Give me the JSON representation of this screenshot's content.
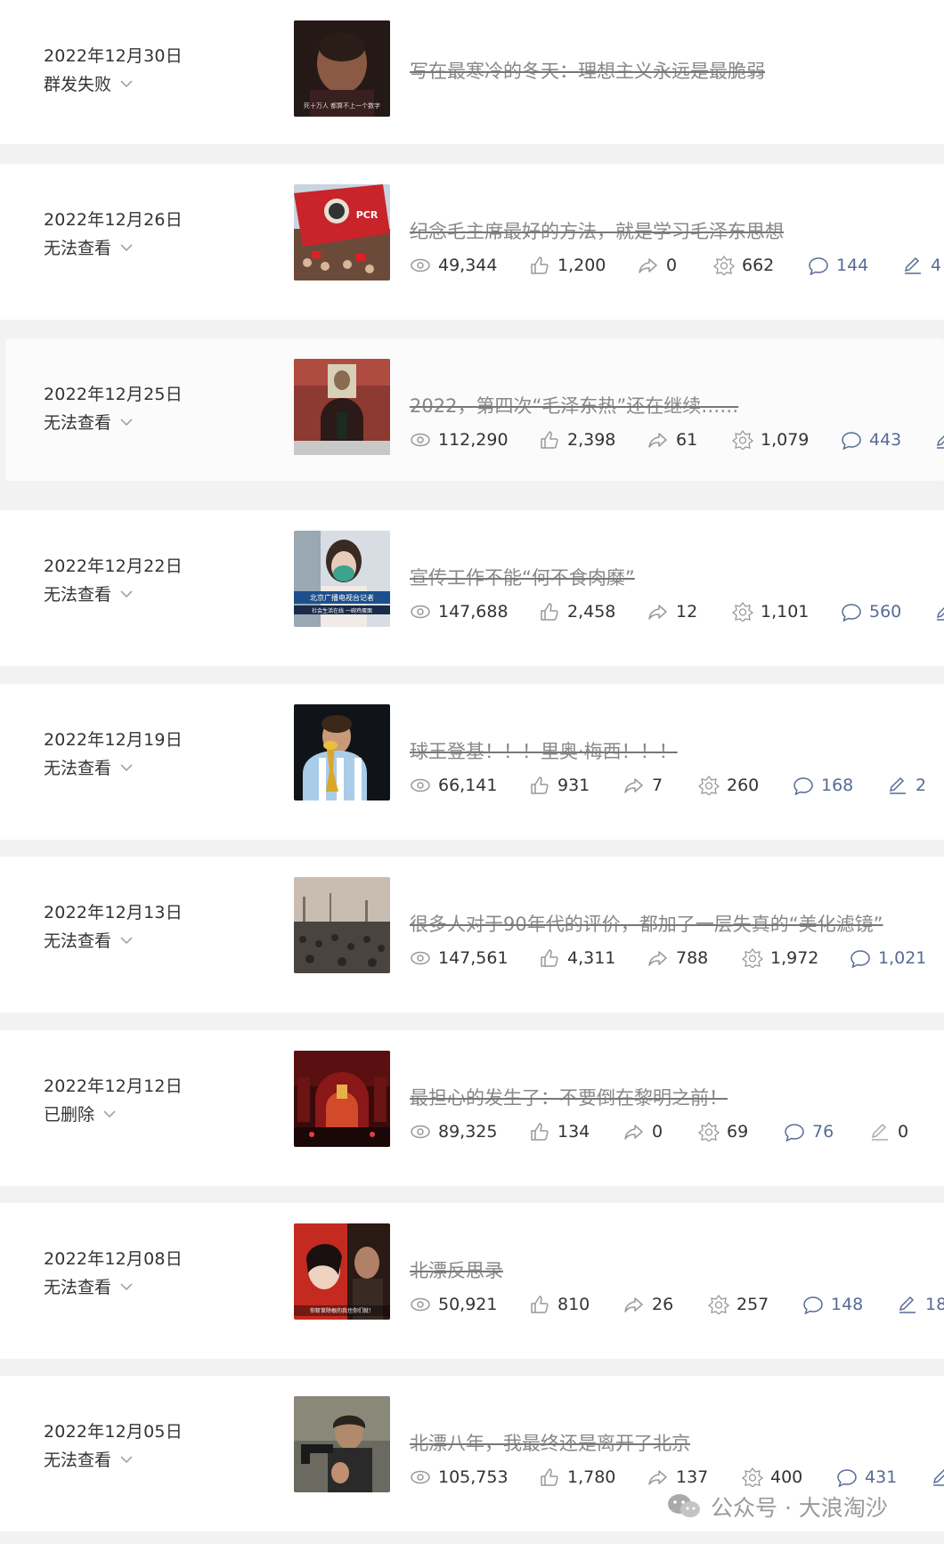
{
  "articles": [
    {
      "date": "2022年12月30日",
      "status": "群发失败",
      "title": "写在最寒冷的冬天：理想主义永远是最脆弱",
      "has_stats": false
    },
    {
      "date": "2022年12月26日",
      "status": "无法查看",
      "title": "纪念毛主席最好的方法，就是学习毛泽东思想",
      "has_stats": true,
      "stats": {
        "reads": "49,344",
        "likes": "1,200",
        "shares": "0",
        "wows": "662",
        "comments": "144",
        "notes": "4"
      }
    },
    {
      "date": "2022年12月25日",
      "status": "无法查看",
      "title": "2022，第四次“毛泽东热”还在继续……",
      "has_stats": true,
      "stats": {
        "reads": "112,290",
        "likes": "2,398",
        "shares": "61",
        "wows": "1,079",
        "comments": "443",
        "notes": ""
      }
    },
    {
      "date": "2022年12月22日",
      "status": "无法查看",
      "title": "宣传工作不能“何不食肉糜”",
      "has_stats": true,
      "stats": {
        "reads": "147,688",
        "likes": "2,458",
        "shares": "12",
        "wows": "1,101",
        "comments": "560",
        "notes": ""
      }
    },
    {
      "date": "2022年12月19日",
      "status": "无法查看",
      "title": "球王登基！！！里奥·梅西！！！",
      "has_stats": true,
      "stats": {
        "reads": "66,141",
        "likes": "931",
        "shares": "7",
        "wows": "260",
        "comments": "168",
        "notes": "2"
      }
    },
    {
      "date": "2022年12月13日",
      "status": "无法查看",
      "title": "很多人对于90年代的评价，都加了一层失真的“美化滤镜”",
      "has_stats": true,
      "stats": {
        "reads": "147,561",
        "likes": "4,311",
        "shares": "788",
        "wows": "1,972",
        "comments": "1,021",
        "notes": ""
      }
    },
    {
      "date": "2022年12月12日",
      "status": "已删除",
      "title": "最担心的发生了：不要倒在黎明之前！",
      "has_stats": true,
      "stats": {
        "reads": "89,325",
        "likes": "134",
        "shares": "0",
        "wows": "69",
        "comments": "76",
        "notes": "0"
      }
    },
    {
      "date": "2022年12月08日",
      "status": "无法查看",
      "title": "北漂反思录",
      "has_stats": true,
      "stats": {
        "reads": "50,921",
        "likes": "810",
        "shares": "26",
        "wows": "257",
        "comments": "148",
        "notes": "18"
      }
    },
    {
      "date": "2022年12月05日",
      "status": "无法查看",
      "title": "北漂八年，我最终还是离开了北京",
      "has_stats": true,
      "stats": {
        "reads": "105,753",
        "likes": "1,780",
        "shares": "137",
        "wows": "400",
        "comments": "431",
        "notes": ""
      }
    }
  ],
  "thumb_captions": {
    "a0": "死十万人 都算不上一个数字",
    "a1": "PCR",
    "a3": "北京广播电视台记者",
    "a3b": "社会生活在线 一碗鸡蛋面",
    "a7": "你斩草除根的我也你们就！"
  },
  "watermark": "公众号 · 大浪淘沙",
  "colors": {
    "link": "#576b95",
    "text": "#333333",
    "title_strike": "#888888",
    "background": "#f2f2f2"
  }
}
